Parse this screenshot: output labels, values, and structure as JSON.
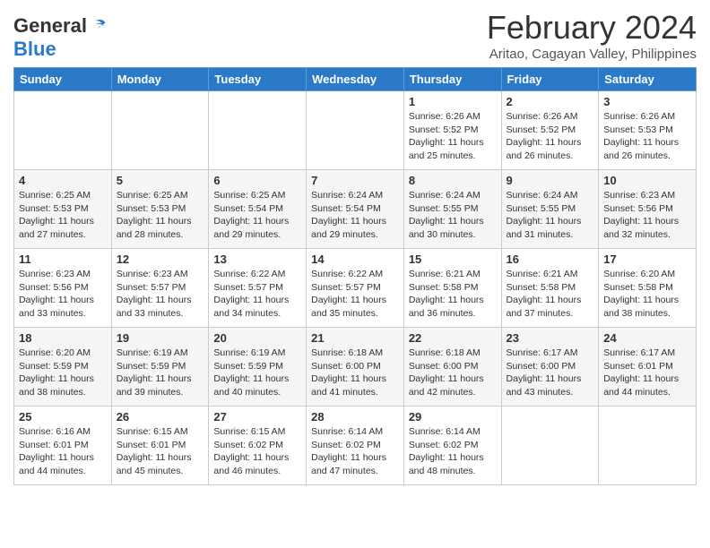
{
  "header": {
    "logo_general": "General",
    "logo_blue": "Blue",
    "month_year": "February 2024",
    "location": "Aritao, Cagayan Valley, Philippines"
  },
  "days_of_week": [
    "Sunday",
    "Monday",
    "Tuesday",
    "Wednesday",
    "Thursday",
    "Friday",
    "Saturday"
  ],
  "weeks": [
    [
      {
        "day": "",
        "info": ""
      },
      {
        "day": "",
        "info": ""
      },
      {
        "day": "",
        "info": ""
      },
      {
        "day": "",
        "info": ""
      },
      {
        "day": "1",
        "info": "Sunrise: 6:26 AM\nSunset: 5:52 PM\nDaylight: 11 hours and 25 minutes."
      },
      {
        "day": "2",
        "info": "Sunrise: 6:26 AM\nSunset: 5:52 PM\nDaylight: 11 hours and 26 minutes."
      },
      {
        "day": "3",
        "info": "Sunrise: 6:26 AM\nSunset: 5:53 PM\nDaylight: 11 hours and 26 minutes."
      }
    ],
    [
      {
        "day": "4",
        "info": "Sunrise: 6:25 AM\nSunset: 5:53 PM\nDaylight: 11 hours and 27 minutes."
      },
      {
        "day": "5",
        "info": "Sunrise: 6:25 AM\nSunset: 5:53 PM\nDaylight: 11 hours and 28 minutes."
      },
      {
        "day": "6",
        "info": "Sunrise: 6:25 AM\nSunset: 5:54 PM\nDaylight: 11 hours and 29 minutes."
      },
      {
        "day": "7",
        "info": "Sunrise: 6:24 AM\nSunset: 5:54 PM\nDaylight: 11 hours and 29 minutes."
      },
      {
        "day": "8",
        "info": "Sunrise: 6:24 AM\nSunset: 5:55 PM\nDaylight: 11 hours and 30 minutes."
      },
      {
        "day": "9",
        "info": "Sunrise: 6:24 AM\nSunset: 5:55 PM\nDaylight: 11 hours and 31 minutes."
      },
      {
        "day": "10",
        "info": "Sunrise: 6:23 AM\nSunset: 5:56 PM\nDaylight: 11 hours and 32 minutes."
      }
    ],
    [
      {
        "day": "11",
        "info": "Sunrise: 6:23 AM\nSunset: 5:56 PM\nDaylight: 11 hours and 33 minutes."
      },
      {
        "day": "12",
        "info": "Sunrise: 6:23 AM\nSunset: 5:57 PM\nDaylight: 11 hours and 33 minutes."
      },
      {
        "day": "13",
        "info": "Sunrise: 6:22 AM\nSunset: 5:57 PM\nDaylight: 11 hours and 34 minutes."
      },
      {
        "day": "14",
        "info": "Sunrise: 6:22 AM\nSunset: 5:57 PM\nDaylight: 11 hours and 35 minutes."
      },
      {
        "day": "15",
        "info": "Sunrise: 6:21 AM\nSunset: 5:58 PM\nDaylight: 11 hours and 36 minutes."
      },
      {
        "day": "16",
        "info": "Sunrise: 6:21 AM\nSunset: 5:58 PM\nDaylight: 11 hours and 37 minutes."
      },
      {
        "day": "17",
        "info": "Sunrise: 6:20 AM\nSunset: 5:58 PM\nDaylight: 11 hours and 38 minutes."
      }
    ],
    [
      {
        "day": "18",
        "info": "Sunrise: 6:20 AM\nSunset: 5:59 PM\nDaylight: 11 hours and 38 minutes."
      },
      {
        "day": "19",
        "info": "Sunrise: 6:19 AM\nSunset: 5:59 PM\nDaylight: 11 hours and 39 minutes."
      },
      {
        "day": "20",
        "info": "Sunrise: 6:19 AM\nSunset: 5:59 PM\nDaylight: 11 hours and 40 minutes."
      },
      {
        "day": "21",
        "info": "Sunrise: 6:18 AM\nSunset: 6:00 PM\nDaylight: 11 hours and 41 minutes."
      },
      {
        "day": "22",
        "info": "Sunrise: 6:18 AM\nSunset: 6:00 PM\nDaylight: 11 hours and 42 minutes."
      },
      {
        "day": "23",
        "info": "Sunrise: 6:17 AM\nSunset: 6:00 PM\nDaylight: 11 hours and 43 minutes."
      },
      {
        "day": "24",
        "info": "Sunrise: 6:17 AM\nSunset: 6:01 PM\nDaylight: 11 hours and 44 minutes."
      }
    ],
    [
      {
        "day": "25",
        "info": "Sunrise: 6:16 AM\nSunset: 6:01 PM\nDaylight: 11 hours and 44 minutes."
      },
      {
        "day": "26",
        "info": "Sunrise: 6:15 AM\nSunset: 6:01 PM\nDaylight: 11 hours and 45 minutes."
      },
      {
        "day": "27",
        "info": "Sunrise: 6:15 AM\nSunset: 6:02 PM\nDaylight: 11 hours and 46 minutes."
      },
      {
        "day": "28",
        "info": "Sunrise: 6:14 AM\nSunset: 6:02 PM\nDaylight: 11 hours and 47 minutes."
      },
      {
        "day": "29",
        "info": "Sunrise: 6:14 AM\nSunset: 6:02 PM\nDaylight: 11 hours and 48 minutes."
      },
      {
        "day": "",
        "info": ""
      },
      {
        "day": "",
        "info": ""
      }
    ]
  ]
}
